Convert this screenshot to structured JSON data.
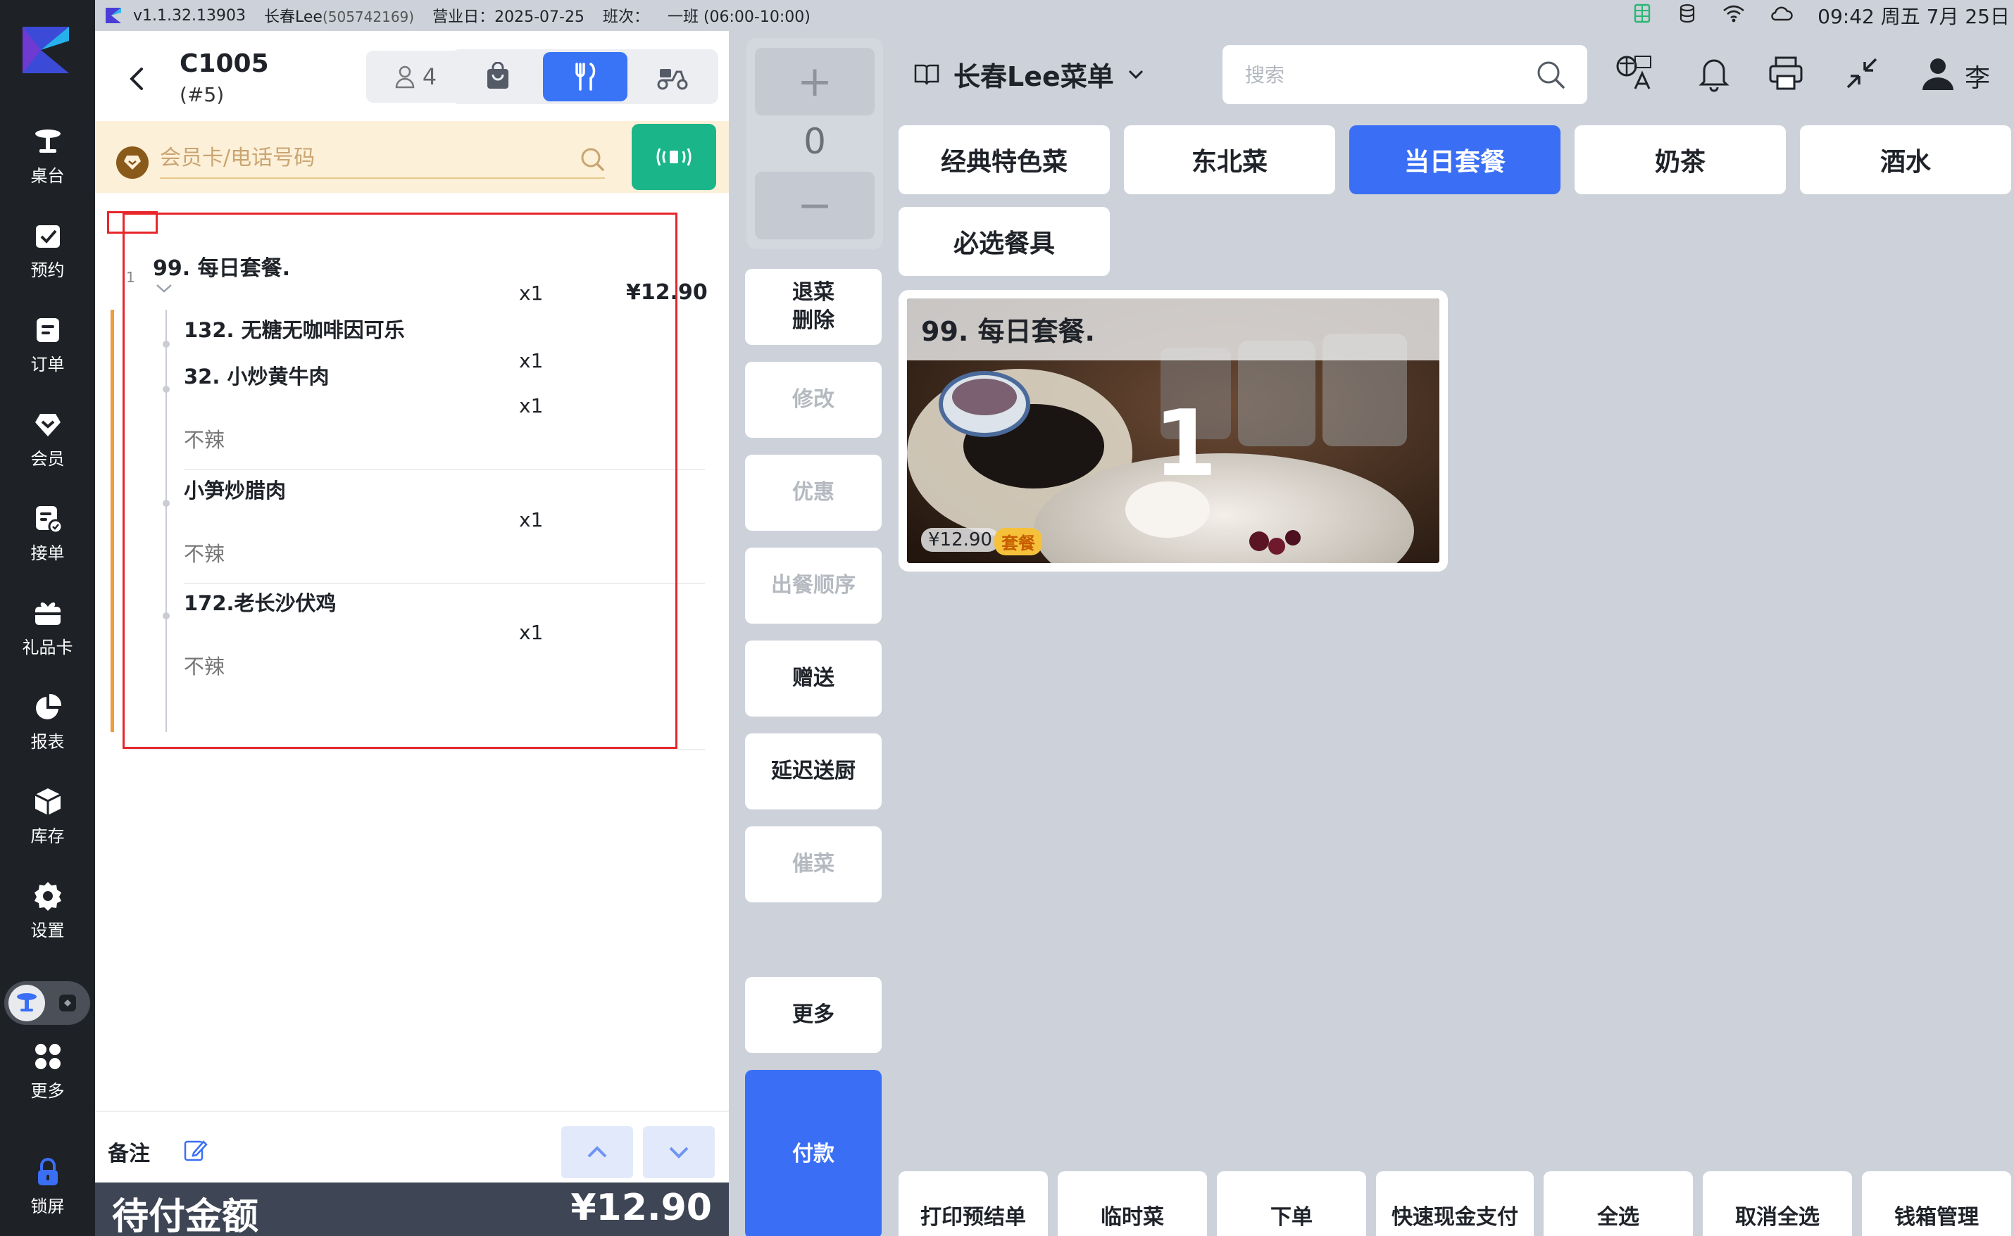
{
  "status_bar": {
    "version": "v1.1.32.13903",
    "store_name": "长春Lee",
    "store_id": "(505742169)",
    "business_day": "营业日：2025-07-25",
    "shift_label": "班次：",
    "shift": "一班 (06:00-10:00)",
    "time": "09:42 周五 7月 25日"
  },
  "nav": {
    "items": [
      {
        "label": "桌台",
        "icon": "table-icon"
      },
      {
        "label": "预约",
        "icon": "reservation-icon"
      },
      {
        "label": "订单",
        "icon": "order-icon"
      },
      {
        "label": "会员",
        "icon": "member-icon"
      },
      {
        "label": "接单",
        "icon": "accept-order-icon"
      },
      {
        "label": "礼品卡",
        "icon": "gift-card-icon"
      },
      {
        "label": "报表",
        "icon": "report-icon"
      },
      {
        "label": "库存",
        "icon": "inventory-icon"
      },
      {
        "label": "设置",
        "icon": "settings-icon"
      }
    ],
    "more_label": "更多",
    "lock_label": "锁屏"
  },
  "order": {
    "table_no": "C1005",
    "table_sub": "(#5)",
    "guests": "4",
    "member_placeholder": "会员卡/电话号码",
    "combo": {
      "index": "1",
      "name": "99. 每日套餐.",
      "qty": "x1",
      "price": "¥12.90"
    },
    "sub_items": [
      {
        "name": "132. 无糖无咖啡因可乐",
        "qty": "x1",
        "note": ""
      },
      {
        "name": "32. 小炒黄牛肉",
        "qty": "x1",
        "note": "不辣"
      },
      {
        "name": "小笋炒腊肉",
        "qty": "x1",
        "note": "不辣"
      },
      {
        "name": "172.老长沙伏鸡",
        "qty": "x1",
        "note": "不辣"
      }
    ],
    "note_label": "备注",
    "due_label": "待付金额",
    "due_amount": "¥12.90"
  },
  "quantity": {
    "value": "0",
    "plus": "+",
    "minus": "−"
  },
  "actions": {
    "return_delete_1": "退菜",
    "return_delete_2": "删除",
    "modify": "修改",
    "discount": "优惠",
    "serve_order": "出餐顺序",
    "gift": "赠送",
    "delay_kitchen": "延迟送厨",
    "rush": "催菜",
    "more": "更多",
    "pay": "付款"
  },
  "menu": {
    "title": "长春Lee菜单",
    "search_placeholder": "搜索",
    "user": "李",
    "categories": [
      "经典特色菜",
      "东北菜",
      "当日套餐",
      "奶茶",
      "酒水",
      "必选餐具"
    ],
    "active_category": "当日套餐",
    "dish": {
      "name": "99. 每日套餐.",
      "count": "1",
      "price": "¥12.90",
      "tag": "套餐"
    }
  },
  "bottom_actions": [
    "打印预结单",
    "临时菜",
    "下单",
    "快速现金支付",
    "全选",
    "取消全选",
    "钱箱管理"
  ],
  "colors": {
    "accent": "#3a6ff5",
    "nav_bg": "#1e2227",
    "nfc_green": "#1bb58a",
    "member_bar": "#fdf0d8",
    "selection_red": "#e8262a"
  }
}
